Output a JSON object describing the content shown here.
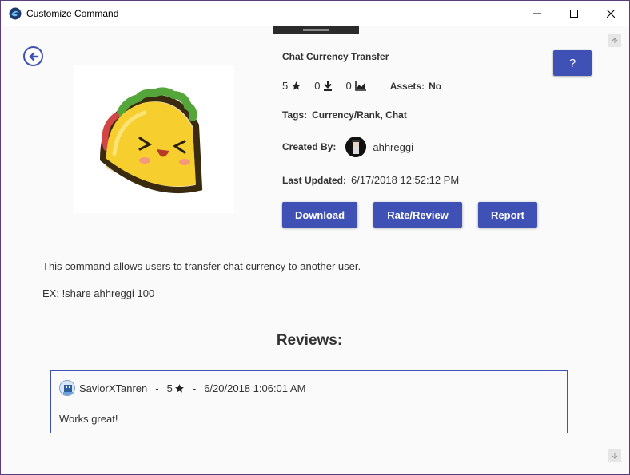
{
  "window": {
    "title": "Customize Command",
    "minimize_icon": "minimize-icon",
    "maximize_icon": "maximize-icon",
    "close_icon": "close-icon"
  },
  "command": {
    "name": "Chat Currency Transfer",
    "rating": "5",
    "downloads": "0",
    "installs": "0",
    "assets_label": "Assets:",
    "assets_value": "No",
    "tags_label": "Tags:",
    "tags_value": "Currency/Rank, Chat",
    "created_label": "Created By:",
    "created_by": "ahhreggi",
    "updated_label": "Last Updated:",
    "updated_value": "6/17/2018 12:52:12 PM",
    "description": "This command allows users to transfer chat currency to another user.",
    "example": "EX: !share ahhreggi 100"
  },
  "buttons": {
    "help": "?",
    "download": "Download",
    "rate_review": "Rate/Review",
    "report": "Report"
  },
  "reviews": {
    "heading": "Reviews:",
    "items": [
      {
        "user": "SaviorXTanren",
        "separator1": "-",
        "rating": "5",
        "separator2": "-",
        "date": "6/20/2018 1:06:01 AM",
        "text": "Works great!"
      }
    ]
  },
  "colors": {
    "accent": "#3f51b5",
    "background": "#fafafa",
    "text": "#333333"
  }
}
